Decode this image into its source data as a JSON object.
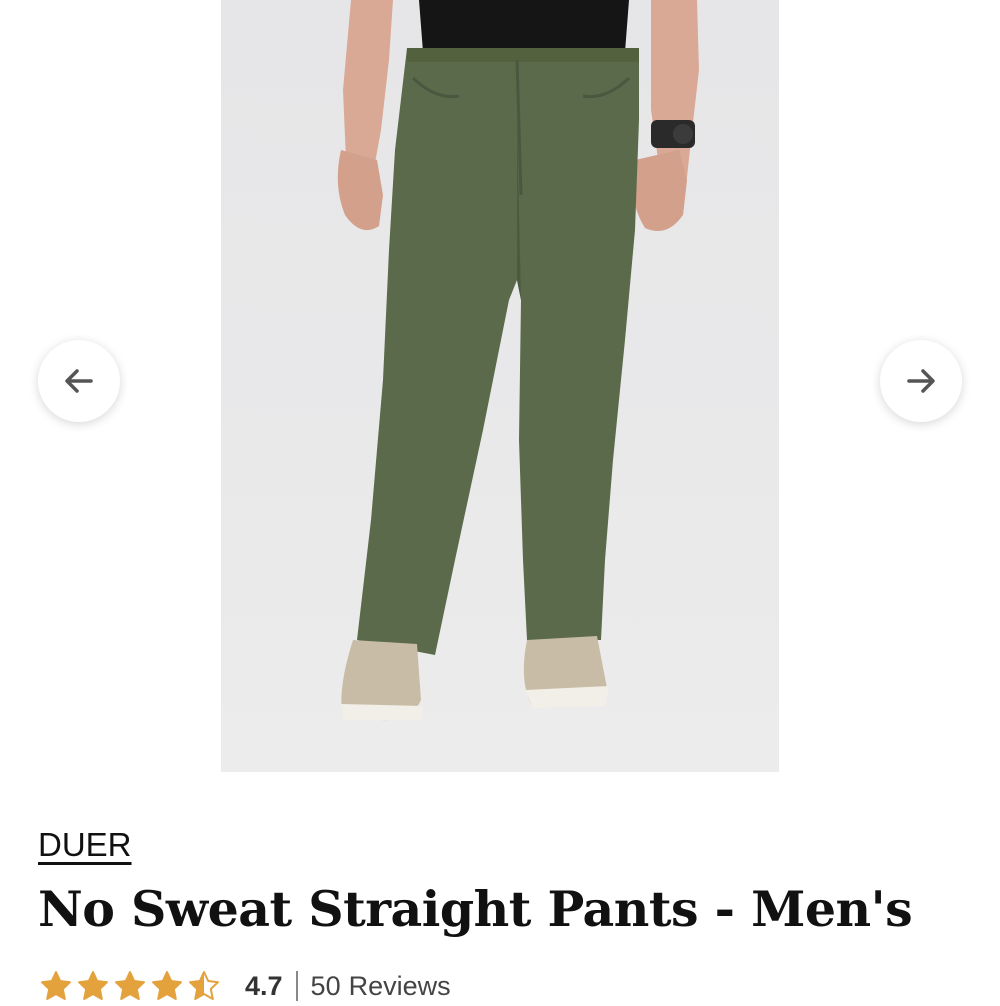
{
  "product": {
    "brand": "DUER",
    "title": "No Sweat Straight Pants - Men's",
    "image_alt": "Olive green straight-leg pants worn with black t-shirt and beige sneakers"
  },
  "gallery": {
    "prev_icon": "arrow-left-icon",
    "next_icon": "arrow-right-icon"
  },
  "rating": {
    "value": "4.7",
    "stars_filled": 4.5,
    "stars_total": 5,
    "review_count": "50",
    "review_label": "Reviews",
    "star_color": "#e3a23b"
  },
  "colors": {
    "pants": "#5b6a4b",
    "shirt": "#151515",
    "image_bg": "#e8e8e9"
  }
}
